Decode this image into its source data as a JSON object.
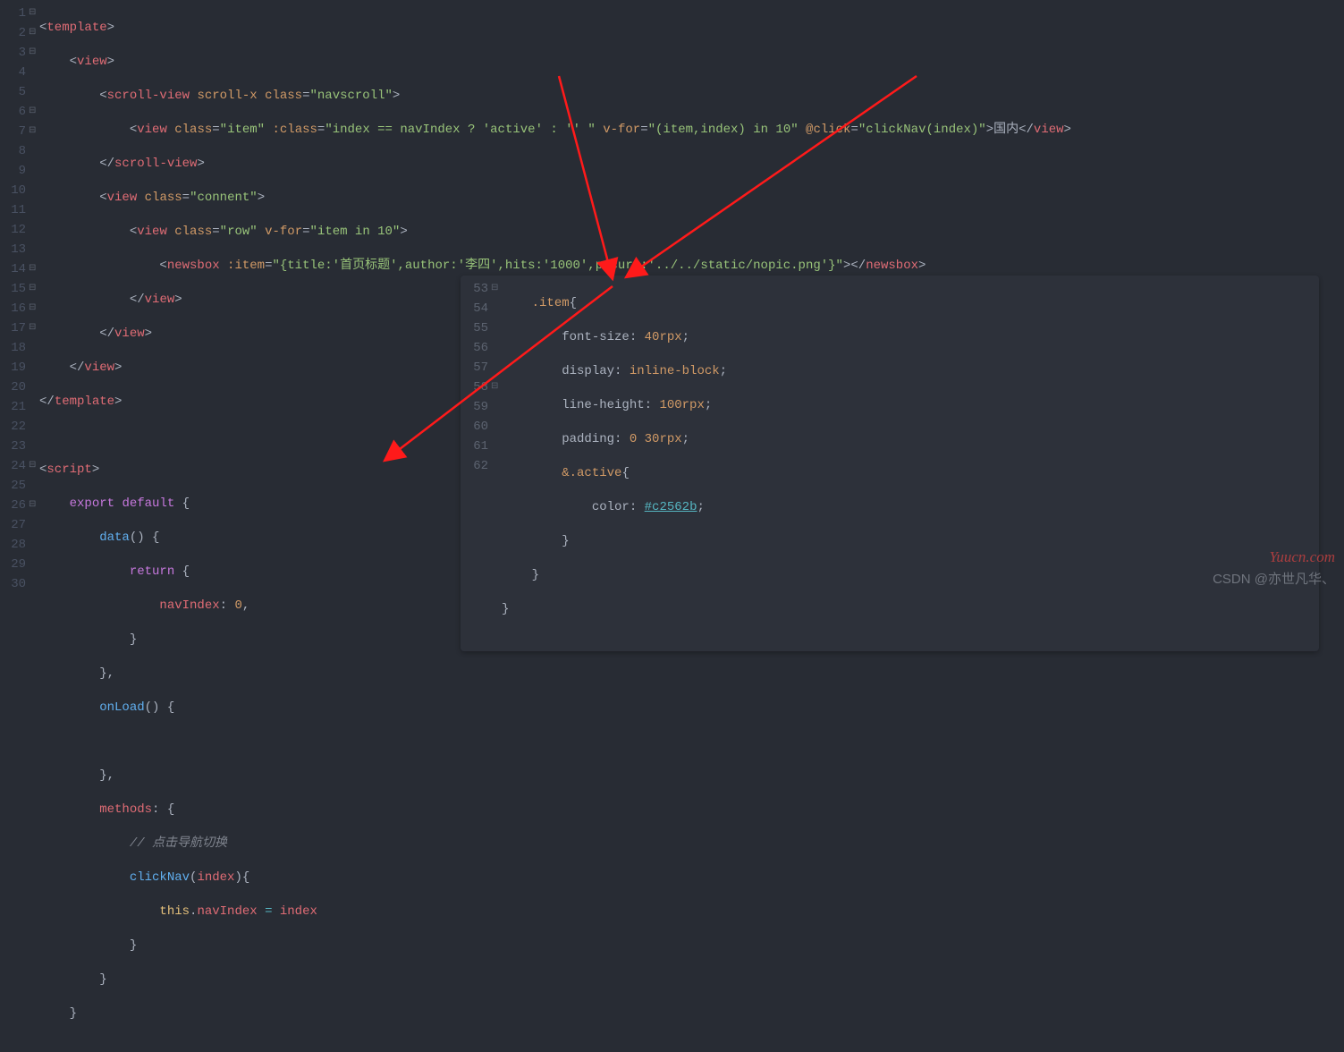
{
  "main_gutter": [
    {
      "n": "1",
      "fold": "⊟"
    },
    {
      "n": "2",
      "fold": "⊟"
    },
    {
      "n": "3",
      "fold": "⊟"
    },
    {
      "n": "4",
      "fold": ""
    },
    {
      "n": "5",
      "fold": ""
    },
    {
      "n": "6",
      "fold": "⊟"
    },
    {
      "n": "7",
      "fold": "⊟"
    },
    {
      "n": "8",
      "fold": ""
    },
    {
      "n": "9",
      "fold": ""
    },
    {
      "n": "10",
      "fold": ""
    },
    {
      "n": "11",
      "fold": ""
    },
    {
      "n": "12",
      "fold": ""
    },
    {
      "n": "13",
      "fold": ""
    },
    {
      "n": "14",
      "fold": "⊟"
    },
    {
      "n": "15",
      "fold": "⊟"
    },
    {
      "n": "16",
      "fold": "⊟"
    },
    {
      "n": "17",
      "fold": "⊟"
    },
    {
      "n": "18",
      "fold": ""
    },
    {
      "n": "19",
      "fold": ""
    },
    {
      "n": "20",
      "fold": ""
    },
    {
      "n": "21",
      "fold": ""
    },
    {
      "n": "22",
      "fold": ""
    },
    {
      "n": "23",
      "fold": ""
    },
    {
      "n": "24",
      "fold": "⊟"
    },
    {
      "n": "25",
      "fold": ""
    },
    {
      "n": "26",
      "fold": "⊟"
    },
    {
      "n": "27",
      "fold": ""
    },
    {
      "n": "28",
      "fold": ""
    },
    {
      "n": "29",
      "fold": ""
    },
    {
      "n": "30",
      "fold": ""
    }
  ],
  "panel_gutter": [
    {
      "n": "53",
      "fold": "⊟"
    },
    {
      "n": "54",
      "fold": ""
    },
    {
      "n": "55",
      "fold": ""
    },
    {
      "n": "56",
      "fold": ""
    },
    {
      "n": "57",
      "fold": ""
    },
    {
      "n": "58",
      "fold": "⊟"
    },
    {
      "n": "59",
      "fold": ""
    },
    {
      "n": "60",
      "fold": ""
    },
    {
      "n": "61",
      "fold": ""
    },
    {
      "n": "62",
      "fold": ""
    }
  ],
  "txt": {
    "template_o": "template",
    "template_c": "template",
    "view": "view",
    "scroll_view": "scroll-view",
    "newsbox": "newsbox",
    "script": "script",
    "scroll_x": "scroll-x",
    "class": "class",
    "dyn_class": ":class",
    "v_for": "v-for",
    "at_click": "@click",
    "dyn_item": ":item",
    "navscroll": "\"navscroll\"",
    "item": "\"item\"",
    "connent": "\"connent\"",
    "row": "\"row\"",
    "class_expr": "\"index == navIndex ? 'active' : '' \"",
    "vfor_expr": "\"(item,index) in 10\"",
    "click_expr": "\"clickNav(index)\"",
    "vfor_item": "\"item in 10\"",
    "newsbox_item": "\"{title:'首页标题',author:'李四',hits:'1000',picurl:'../../static/nopic.png'}\"",
    "guonei": "国内",
    "export": "export",
    "default": "default",
    "return": "return",
    "this": "this",
    "data": "data",
    "onLoad": "onLoad",
    "methods": "methods",
    "clickNav": "clickNav",
    "navIndex": "navIndex",
    "index": "index",
    "zero": "0",
    "comment": "// 点击导航切换",
    "sel_item": ".item",
    "sel_active": "&.active",
    "font_size": "font-size",
    "v40rpx": "40rpx",
    "display": "display",
    "inline_block": "inline-block",
    "line_height": "line-height",
    "v100rpx": "100rpx",
    "padding": "padding",
    "v0": "0",
    "v30rpx": "30rpx",
    "color": "color",
    "hex": "#c2562b"
  },
  "watermark": {
    "site": "Yuucn.com",
    "csdn": "CSDN @亦世凡华、"
  }
}
